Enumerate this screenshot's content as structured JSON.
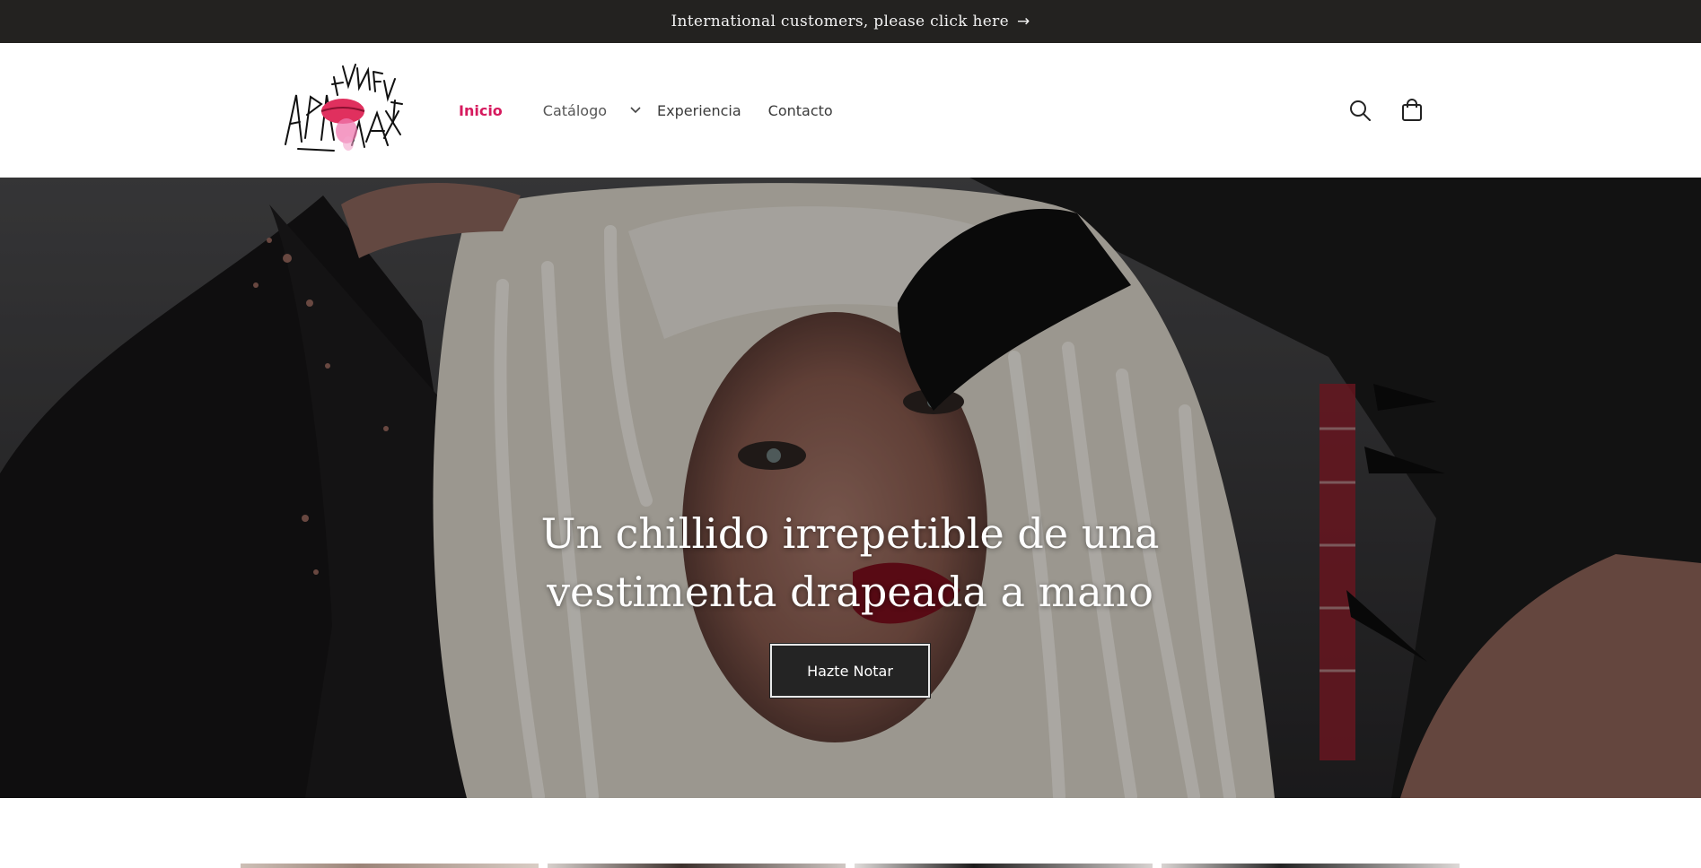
{
  "announcement": {
    "text": "International customers, please click here",
    "arrow": "→"
  },
  "header": {
    "logo_alt": "Labios Enfermos",
    "nav": [
      {
        "label": "Inicio",
        "active": true
      },
      {
        "label": "Catálogo",
        "has_dropdown": true
      },
      {
        "label": "Experiencia"
      },
      {
        "label": "Contacto"
      }
    ],
    "icons": [
      "search-icon",
      "cart-icon"
    ]
  },
  "hero": {
    "heading_line1": "Un chillido irrepetible de una",
    "heading_line2": "vestimenta drapeada a mano",
    "button_label": "Hazte Notar"
  },
  "colors": {
    "announcement_bg": "#232220",
    "active_nav": "#d61a5e",
    "button_bg": "#242424"
  }
}
